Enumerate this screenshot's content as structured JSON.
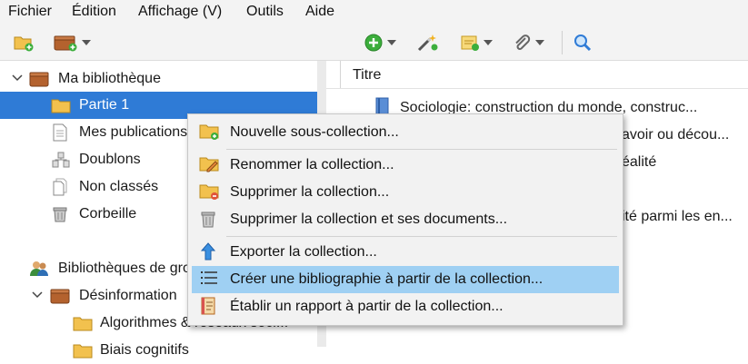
{
  "menubar": {
    "items": [
      {
        "label": "Fichier"
      },
      {
        "label": "Édition"
      },
      {
        "label": "Affichage (V)"
      },
      {
        "label": "Outils"
      },
      {
        "label": "Aide"
      }
    ]
  },
  "toolbar": {
    "icons": [
      "new-collection-icon",
      "new-library-icon",
      "new-item-icon",
      "magic-wand-icon",
      "new-note-icon",
      "attachment-icon",
      "search-icon"
    ]
  },
  "sidebar": {
    "library": "Ma bibliothèque",
    "items": [
      {
        "label": "Partie 1"
      },
      {
        "label": "Mes publications"
      },
      {
        "label": "Doublons"
      },
      {
        "label": "Non classés"
      },
      {
        "label": "Corbeille"
      }
    ],
    "groups_label": "Bibliothèques de groupe",
    "group": "Désinformation",
    "subitems": [
      {
        "label": "Algorithmes & réseaux soci..."
      },
      {
        "label": "Biais cognitifs"
      }
    ]
  },
  "items_pane": {
    "column_title": "Titre",
    "rows": [
      {
        "title": "Sociologie: construction du monde, construc..."
      },
      {
        "title": "avoir ou décou..."
      },
      {
        "title": "éalité"
      },
      {
        "title": "ité parmi les en..."
      }
    ]
  },
  "context_menu": {
    "items": [
      {
        "label": "Nouvelle sous-collection..."
      },
      {
        "label": "Renommer la collection..."
      },
      {
        "label": "Supprimer la collection..."
      },
      {
        "label": "Supprimer la collection et ses documents..."
      },
      {
        "label": "Exporter la collection..."
      },
      {
        "label": "Créer une bibliographie à partir de la collection..."
      },
      {
        "label": "Établir un rapport à partir de la collection..."
      }
    ],
    "highlighted_index": 5
  },
  "colors": {
    "selection": "#2f7bd6",
    "menu_highlight": "#9fd0f3",
    "folder": "#f2c14e"
  }
}
